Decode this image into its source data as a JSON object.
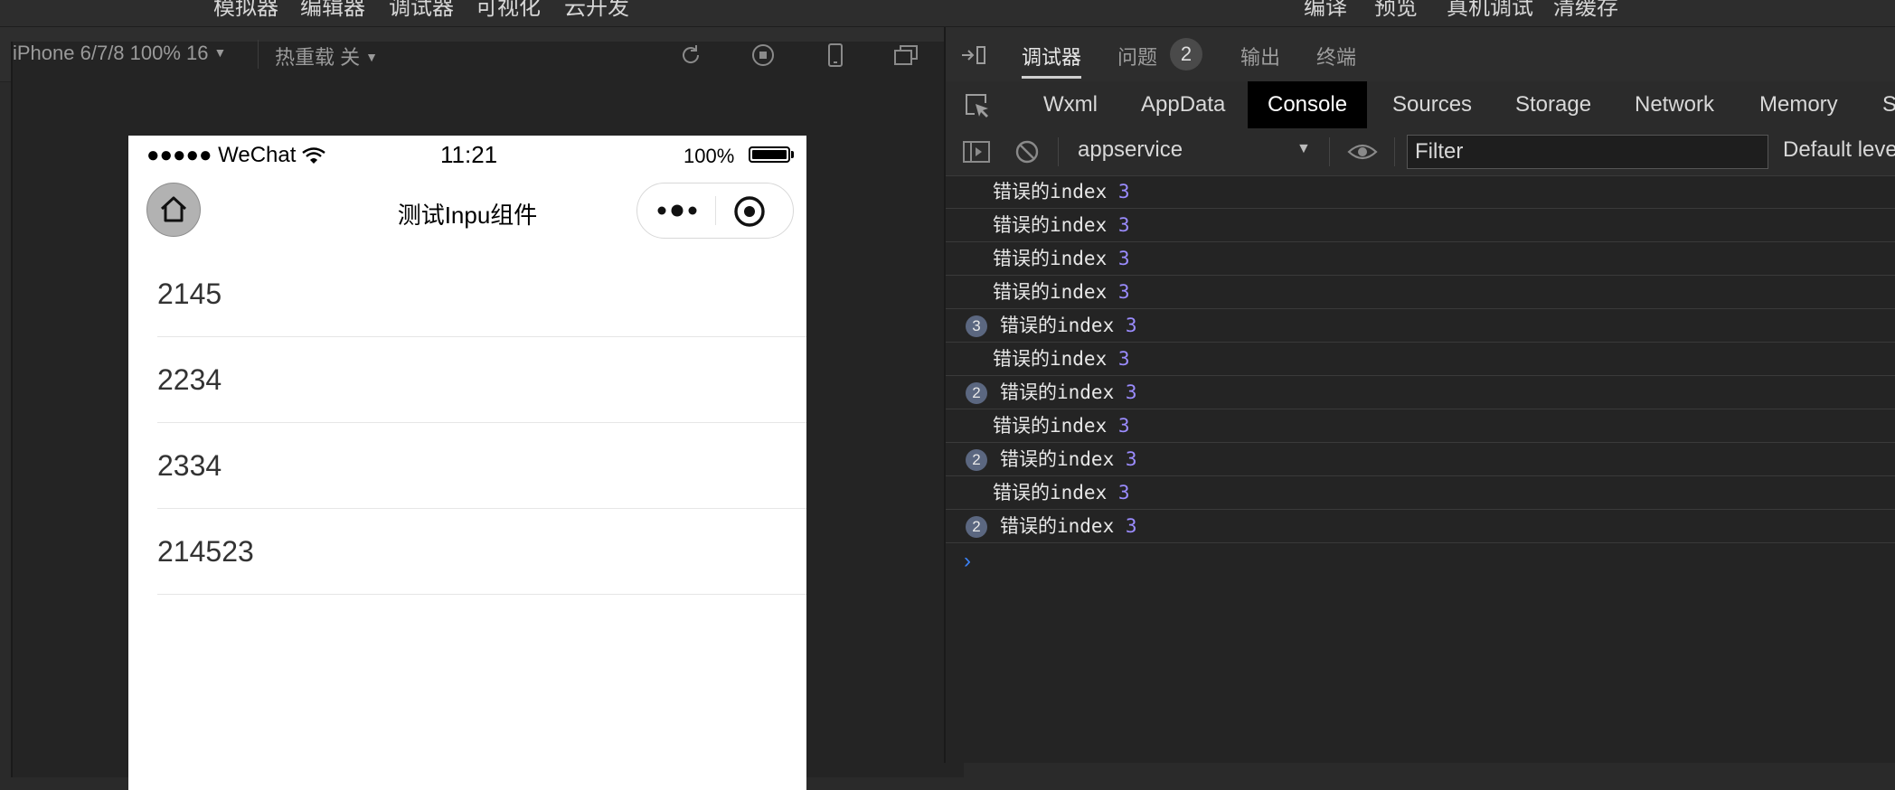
{
  "menu": [
    "模拟器",
    "编辑器",
    "调试器",
    "可视化",
    "云开发",
    "编译",
    "预览",
    "真机调试",
    "清缓存"
  ],
  "simulator": {
    "device": "iPhone 6/7/8 100% 16",
    "hot_reload": "热重载 关"
  },
  "phone": {
    "carrier": "●●●●● WeChat",
    "time": "11:21",
    "battery": "100%",
    "title": "测试Inpu组件",
    "items": [
      "2145",
      "2234",
      "2334",
      "214523"
    ]
  },
  "devtools": {
    "tabs": [
      "调试器",
      "问题",
      "输出",
      "终端"
    ],
    "issues_count": "2",
    "panels": [
      "Wxml",
      "AppData",
      "Console",
      "Sources",
      "Storage",
      "Network",
      "Memory",
      "S"
    ],
    "context": "appservice",
    "filter_placeholder": "Filter",
    "levels": "Default leve",
    "logs": [
      {
        "text": "错误的index",
        "value": "3",
        "count": ""
      },
      {
        "text": "错误的index",
        "value": "3",
        "count": ""
      },
      {
        "text": "错误的index",
        "value": "3",
        "count": ""
      },
      {
        "text": "错误的index",
        "value": "3",
        "count": ""
      },
      {
        "text": "错误的index",
        "value": "3",
        "count": "3"
      },
      {
        "text": "错误的index",
        "value": "3",
        "count": ""
      },
      {
        "text": "错误的index",
        "value": "3",
        "count": "2"
      },
      {
        "text": "错误的index",
        "value": "3",
        "count": ""
      },
      {
        "text": "错误的index",
        "value": "3",
        "count": "2"
      },
      {
        "text": "错误的index",
        "value": "3",
        "count": ""
      },
      {
        "text": "错误的index",
        "value": "3",
        "count": "2"
      }
    ],
    "prompt": "›"
  },
  "colors": {
    "accent": "#9b8cff",
    "badge": "#5b6780",
    "prompt": "#3b82f6"
  }
}
